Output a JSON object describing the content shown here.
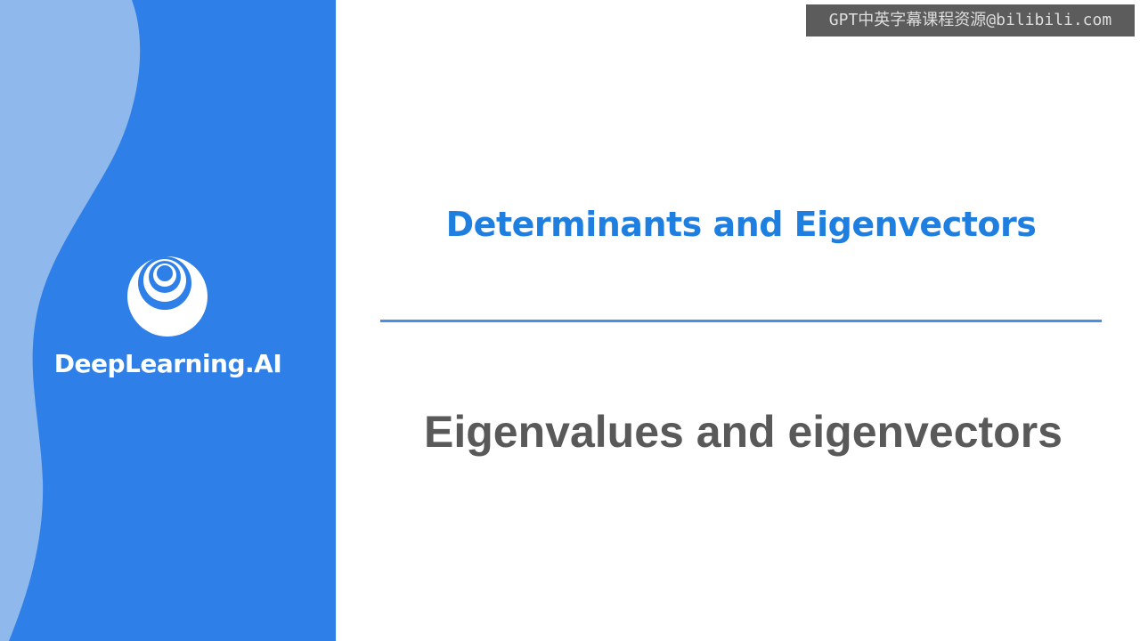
{
  "brand": {
    "name": "DeepLearning.AI",
    "logo_icon": "deeplearning-ai-logo-icon"
  },
  "course": {
    "title": "Determinants and Eigenvectors"
  },
  "lesson": {
    "title": "Eigenvalues and eigenvectors"
  },
  "watermark": {
    "text": "GPT中英字幕课程资源@bilibili.com"
  },
  "colors": {
    "panel": "#2f7fe8",
    "panel_light": "#8fb8ec",
    "accent": "#1f7fe0",
    "divider": "#4a90e2",
    "lesson_text": "#595959"
  }
}
